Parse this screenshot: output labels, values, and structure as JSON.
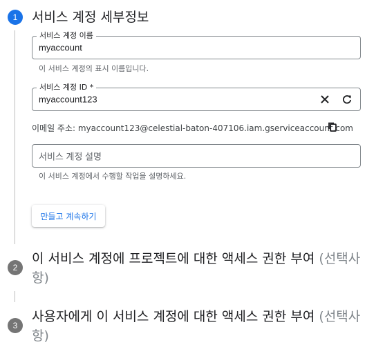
{
  "steps": [
    {
      "number": "1",
      "title": "서비스 계정 세부정보",
      "optional": ""
    },
    {
      "number": "2",
      "title_line1": "이 서비스 계정에 프로젝트에 대한 액세스 권한 부여 ",
      "optional_line1": "(선택사",
      "optional_line2": "항)"
    },
    {
      "number": "3",
      "title_line1": "사용자에게 이 서비스 계정에 대한 액세스 권한 부여 ",
      "optional_line1": "(선택사",
      "optional_line2": "항)"
    }
  ],
  "form": {
    "name_label": "서비스 계정 이름",
    "name_value": "myaccount",
    "name_hint": "이 서비스 계정의 표시 이름입니다.",
    "id_label": "서비스 계정 ID *",
    "id_value": "myaccount123",
    "email_text": "이메일 주소: myaccount123@celestial-baton-407106.iam.gserviceaccount.com",
    "description_placeholder": "서비스 계정 설명",
    "description_hint": "이 서비스 계정에서 수행할 작업을 설명하세요.",
    "create_button": "만들고 계속하기"
  },
  "colors": {
    "accent": "#1a73e8",
    "inactive_step": "#757575",
    "border": "#80868b"
  },
  "icons": {
    "clear": "close-icon",
    "refresh": "refresh-icon",
    "copy": "copy-icon"
  }
}
